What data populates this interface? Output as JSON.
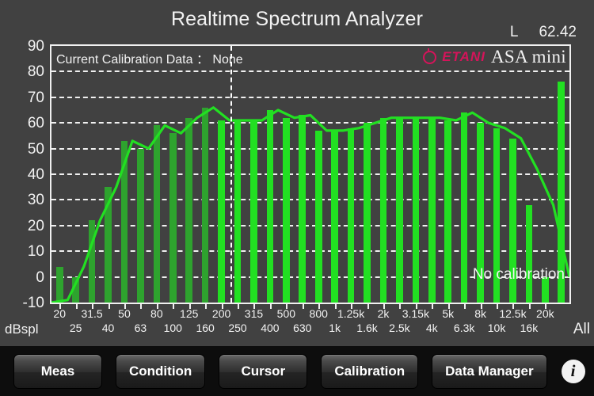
{
  "header": {
    "title": "Realtime Spectrum Analyzer",
    "channel_label": "L",
    "level_value": "62.42"
  },
  "chart_overlay": {
    "calibration_data_text": "Current Calibration Data ： None",
    "no_calibration_text": "No calibration",
    "brand_mark": "ETANI",
    "brand_product": "ASA mini",
    "brand_color": "#d4145a"
  },
  "axis": {
    "y_unit_label": "dBspl",
    "all_band_label": "All"
  },
  "toolbar": {
    "buttons": [
      {
        "label": "Meas"
      },
      {
        "label": "Condition"
      },
      {
        "label": "Cursor"
      },
      {
        "label": "Calibration"
      },
      {
        "label": "Data Manager"
      }
    ],
    "info_icon": "info-icon",
    "info_glyph": "i"
  },
  "chart_data": {
    "type": "bar",
    "title": "Realtime Spectrum Analyzer",
    "xlabel": "dBspl",
    "ylabel": "",
    "ylim": [
      -10,
      90
    ],
    "yticks": [
      90,
      80,
      70,
      60,
      50,
      40,
      30,
      20,
      10,
      0,
      -10
    ],
    "grid": true,
    "legend": "none",
    "bar_color_dark": "#2ea32e",
    "bar_color_bright": "#22e022",
    "line_color": "#22e022",
    "cursor_band": "250",
    "categories": [
      "20",
      "25",
      "31.5",
      "40",
      "50",
      "63",
      "80",
      "100",
      "125",
      "160",
      "200",
      "250",
      "315",
      "400",
      "500",
      "630",
      "800",
      "1k",
      "1.25k",
      "1.6k",
      "2k",
      "2.5k",
      "3.15k",
      "4k",
      "5k",
      "6.3k",
      "8k",
      "10k",
      "12.5k",
      "16k",
      "20k",
      "All"
    ],
    "values": [
      4,
      0,
      22,
      35,
      53,
      50,
      59,
      56,
      62,
      66,
      61,
      61,
      61,
      65,
      62,
      63,
      57,
      57,
      58,
      60,
      62,
      62,
      62,
      62,
      61,
      64,
      60,
      58,
      54,
      28,
      0,
      76
    ],
    "line_values": [
      -9,
      4,
      22,
      35,
      53,
      50,
      59,
      56,
      62,
      66,
      61,
      61,
      61,
      65,
      62,
      63,
      57,
      57,
      58,
      60,
      62,
      62,
      62,
      62,
      61,
      64,
      60,
      58,
      54,
      42,
      28,
      0
    ],
    "series": [
      {
        "name": "bars",
        "values": [
          4,
          0,
          22,
          35,
          53,
          50,
          59,
          56,
          62,
          66,
          61,
          61,
          61,
          65,
          62,
          63,
          57,
          57,
          58,
          60,
          62,
          62,
          62,
          62,
          61,
          64,
          60,
          58,
          54,
          28,
          0,
          76
        ]
      }
    ]
  }
}
